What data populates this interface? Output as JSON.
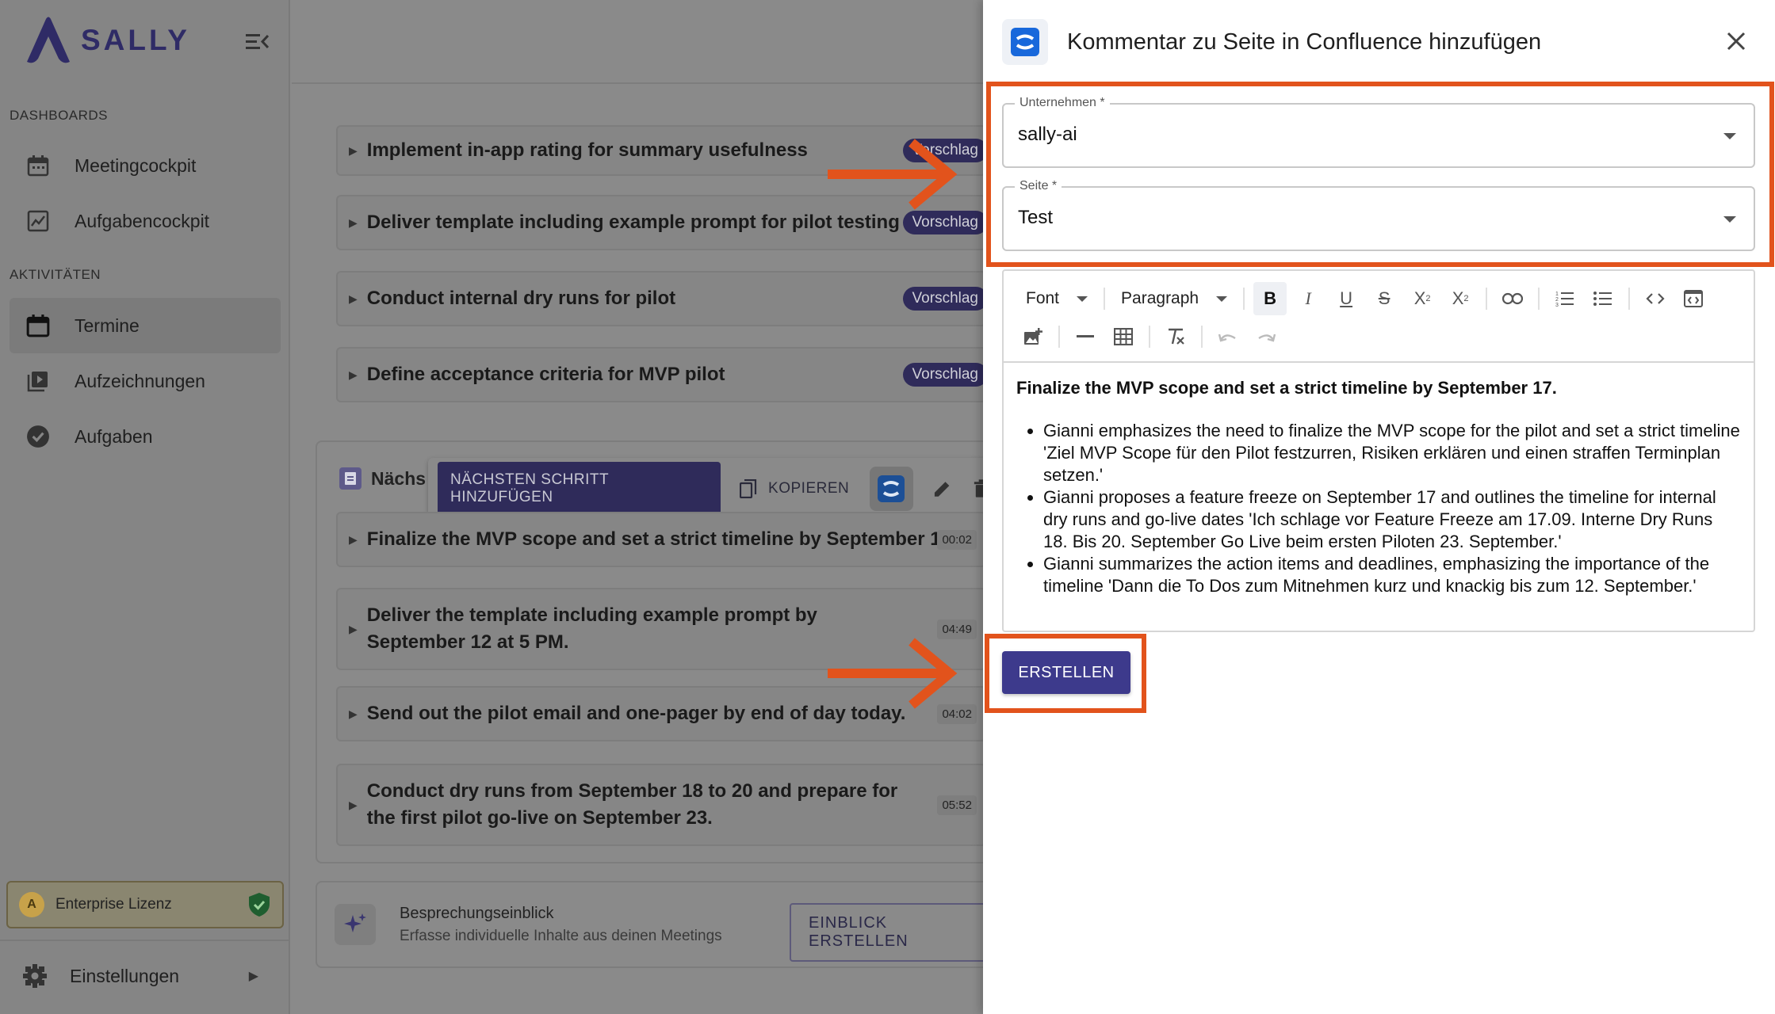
{
  "app": {
    "name": "SALLY"
  },
  "sidebar": {
    "section_dashboards": "DASHBOARDS",
    "section_activities": "AKTIVITÄTEN",
    "items": [
      {
        "label": "Meetingcockpit",
        "icon": "calendar-icon"
      },
      {
        "label": "Aufgabencockpit",
        "icon": "chart-icon"
      },
      {
        "label": "Termine",
        "icon": "calendar-icon",
        "active": true
      },
      {
        "label": "Aufzeichnungen",
        "icon": "video-library-icon"
      },
      {
        "label": "Aufgaben",
        "icon": "check-circle-icon"
      }
    ],
    "license": {
      "label": "Enterprise Lizenz"
    },
    "settings": {
      "label": "Einstellungen"
    }
  },
  "main": {
    "suggestions": [
      {
        "text": "Implement in-app rating for summary usefulness",
        "chip": "Vorschlag"
      },
      {
        "text": "Deliver template including example prompt for pilot testing",
        "chip": "Vorschlag"
      },
      {
        "text": "Conduct internal dry runs for pilot",
        "chip": "Vorschlag"
      },
      {
        "text": "Define acceptance criteria for MVP pilot",
        "chip": "Vorschlag"
      }
    ],
    "next_steps": {
      "header": "Nächs",
      "toolbar": {
        "add_label": "NÄCHSTEN SCHRITT HINZUFÜGEN",
        "copy_label": "KOPIEREN"
      },
      "items": [
        {
          "text": "Finalize the MVP scope and set a strict timeline by September 17.",
          "time": "00:02"
        },
        {
          "text": "Deliver the template including example prompt by September 12 at 5 PM.",
          "time": "04:49"
        },
        {
          "text": "Send out the pilot email and one-pager by end of day today.",
          "time": "04:02"
        },
        {
          "text": "Conduct dry runs from September 18 to 20 and prepare for the first pilot go-live on September 23.",
          "time": "05:52"
        }
      ]
    },
    "insight": {
      "title": "Besprechungseinblick",
      "subtitle": "Erfasse individuelle Inhalte aus deinen Meetings",
      "button": "EINBLICK ERSTELLEN"
    }
  },
  "dialog": {
    "title": "Kommentar zu Seite in Confluence hinzufügen",
    "company": {
      "label": "Unternehmen *",
      "value": "sally-ai"
    },
    "page": {
      "label": "Seite *",
      "value": "Test"
    },
    "editor": {
      "font_select": "Font",
      "paragraph_select": "Paragraph",
      "lead": "Finalize the MVP scope and set a strict timeline by September 17.",
      "bullets": [
        "Gianni emphasizes the need to finalize the MVP scope for the pilot and set a strict timeline 'Ziel MVP Scope für den Pilot festzurren, Risiken erklären und einen straffen Terminplan setzen.'",
        "Gianni proposes a feature freeze on September 17 and outlines the timeline for internal dry runs and go-live dates 'Ich schlage vor Feature Freeze am 17.09. Interne Dry Runs 18. Bis 20. September Go Live beim ersten Piloten 23. September.'",
        "Gianni summarizes the action items and deadlines, emphasizing the importance of the timeline 'Dann die To Dos zum Mitnehmen kurz und knackig bis zum 12. September.'"
      ]
    },
    "submit_label": "ERSTELLEN"
  },
  "colors": {
    "accent": "#3d3a8c",
    "highlight": "#e2531c",
    "confluence": "#1868db"
  }
}
